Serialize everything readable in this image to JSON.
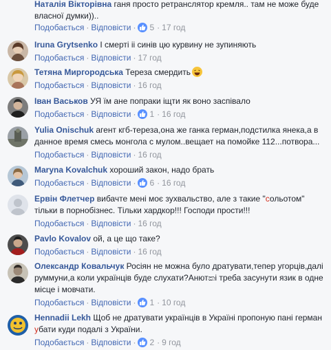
{
  "labels": {
    "like": "Подобається",
    "reply": "Відповісти"
  },
  "comments": [
    {
      "author": "Наталія Вікторівна",
      "text": "ганя просто ретранслятор кремля.. там не може буде власної думки))..",
      "likes": "5",
      "time": "17 год"
    },
    {
      "author": "Iruna Grytsenko",
      "text": "І смерті іі синів цю курвину не зупиняють",
      "likes": "",
      "time": "17 год"
    },
    {
      "author": "Тетяна Миргородська",
      "text": "Тереза смердить",
      "likes": "",
      "time": "16 год"
    },
    {
      "author": "Іван Васьков",
      "text": "УЯ їм ане попраки іщти як воно заспівало",
      "likes": "1",
      "time": "16 год"
    },
    {
      "author": "Yulia Onischuk",
      "text": "агент кгб-тереза,она же ганка герман,подстилка янека,а в данное время смесь монгола с мулом..вещает на помойке 112...потвора...",
      "likes": "",
      "time": "16 год"
    },
    {
      "author": "Maryna Kovalchuk",
      "text": "хороший закон, надо брать",
      "likes": "6",
      "time": "16 год"
    },
    {
      "author": "Ервін Флетчер",
      "text_a": "вибачте мені моє зухвальство, але з такие \"",
      "text_strike": "с",
      "text_b": "ольотом\" тільки в порнобізнес. Тільки хардкор!!! Господи прости!!!",
      "likes": "",
      "time": "16 год"
    },
    {
      "author": "Pavlo Kovalov",
      "text": "ой, а це що таке?",
      "likes": "",
      "time": "16 год"
    },
    {
      "author": "Олександр Ковальчук",
      "text": "Росіян не можна було дратувати,тепер угорців,далі руммуни,а коли українців буде слухати?Анютකі треба засунути язик в одне місце і мовчати.",
      "likes": "1",
      "time": "10 год"
    },
    {
      "author": "Hennadii Lekh",
      "text_a": "Щоб не дратувати українців в Україні пропоную пані герман ",
      "text_strike": "у",
      "text_b": "бати куди подалі з України.",
      "likes": "2",
      "time": "9 год"
    }
  ]
}
